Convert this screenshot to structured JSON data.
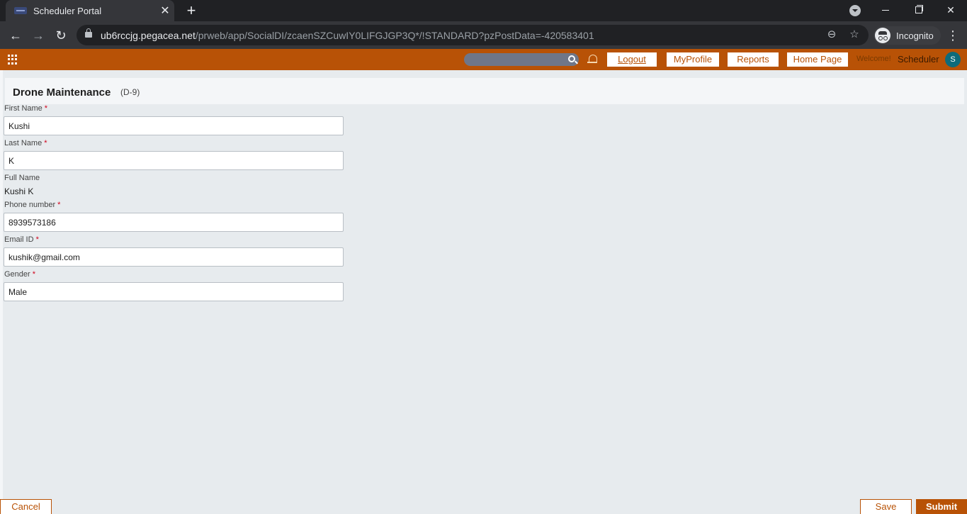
{
  "browser": {
    "tab_title": "Scheduler Portal",
    "tab_close_glyph": "✕",
    "new_tab_glyph": "+",
    "url_host": "ub6rccjg.pegacea.net",
    "url_path": "/prweb/app/SocialDI/zcaenSZCuwIY0LIFGJGP3Q*/!STANDARD?pzPostData=-420583401",
    "incognito_label": "Incognito",
    "back_glyph": "←",
    "forward_glyph": "→",
    "reload_glyph": "↻",
    "zoom_glyph": "⊖",
    "star_glyph": "☆",
    "menu_glyph": "⋮",
    "close_glyph": "✕"
  },
  "header": {
    "logout_label": "Logout",
    "myprofile_label": "MyProfile",
    "reports_label": "Reports",
    "homepage_label": "Home Page",
    "welcome_label": "Welcome!",
    "user_name": "Scheduler",
    "avatar_initial": "S",
    "accent_color": "#b85206"
  },
  "case": {
    "title": "Drone Maintenance",
    "id": "(D-9)"
  },
  "form": {
    "first_name_label": "First Name",
    "first_name_value": "Kushi",
    "last_name_label": "Last Name",
    "last_name_value": "K",
    "full_name_label": "Full Name",
    "full_name_value": "Kushi K",
    "phone_label": "Phone number",
    "phone_value": "8939573186",
    "email_label": "Email ID",
    "email_value": "kushik@gmail.com",
    "gender_label": "Gender",
    "gender_value": "Male",
    "required_marker": "*"
  },
  "footer": {
    "cancel_label": "Cancel",
    "save_label": "Save",
    "submit_label": "Submit"
  }
}
